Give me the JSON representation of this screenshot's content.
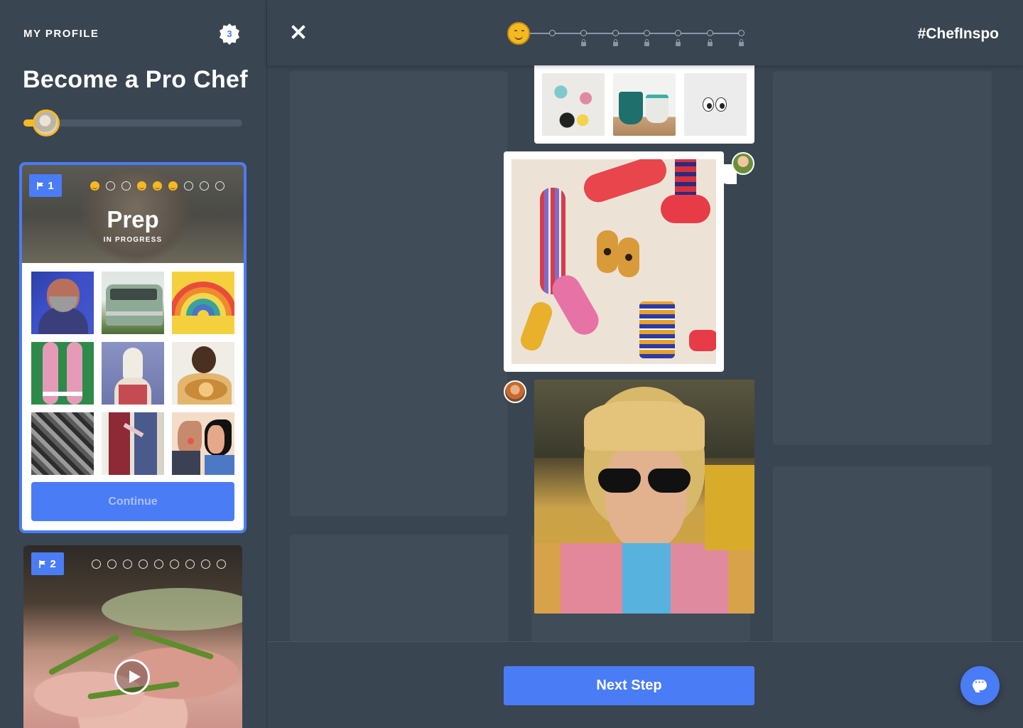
{
  "sidebar": {
    "profile_label": "MY PROFILE",
    "badge_count": "3",
    "title": "Become a Pro Chef",
    "level_progress": 0.1,
    "cards": [
      {
        "flag_number": "1",
        "title": "Prep",
        "status": "IN PROGRESS",
        "steps": [
          "done",
          "empty",
          "empty",
          "done",
          "done",
          "done",
          "empty",
          "empty",
          "empty"
        ],
        "button_label": "Continue"
      },
      {
        "flag_number": "2",
        "steps": [
          "empty",
          "empty",
          "empty",
          "empty",
          "empty",
          "empty",
          "empty",
          "empty",
          "empty"
        ]
      }
    ]
  },
  "topbar": {
    "hashtag": "#ChefInspo",
    "total_steps": 8,
    "locked_steps": 6
  },
  "footer": {
    "next_label": "Next Step"
  },
  "colors": {
    "accent": "#4a7cf6",
    "level": "#f5b921",
    "background": "#3a4552"
  },
  "icons": [
    "flag-icon",
    "close-icon",
    "lock-icon",
    "play-icon",
    "chat-icon",
    "smiley-icon",
    "badge-icon"
  ]
}
